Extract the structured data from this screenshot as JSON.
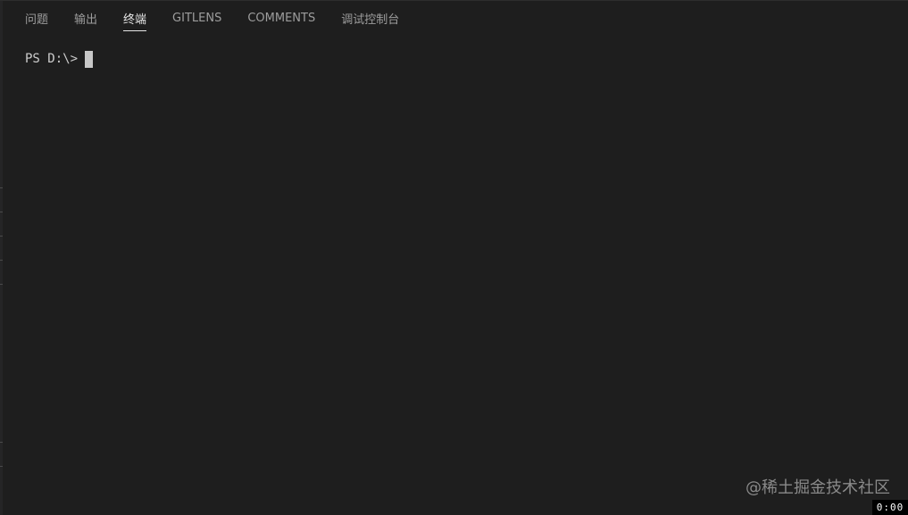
{
  "tabs": [
    {
      "label": "问题",
      "active": false
    },
    {
      "label": "输出",
      "active": false
    },
    {
      "label": "终端",
      "active": true
    },
    {
      "label": "GITLENS",
      "active": false
    },
    {
      "label": "COMMENTS",
      "active": false
    },
    {
      "label": "调试控制台",
      "active": false
    }
  ],
  "terminal": {
    "prompt": "PS D:\\>"
  },
  "watermark": "@稀土掘金技术社区",
  "timer": "0:00",
  "colors": {
    "background": "#1e1e1e",
    "tab_inactive": "#9d9d9d",
    "tab_active": "#e7e7e7",
    "terminal_text": "#cccccc"
  }
}
